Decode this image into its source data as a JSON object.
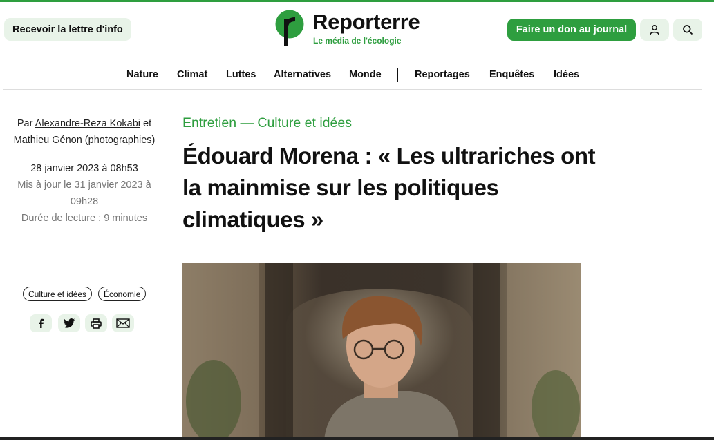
{
  "header": {
    "newsletter_label": "Recevoir la lettre d'info",
    "logo_name": "Reporterre",
    "logo_tagline": "Le média de l'écologie",
    "donate_label": "Faire un don au journal",
    "user_icon": "user-icon",
    "search_icon": "search-icon"
  },
  "nav": {
    "items": [
      {
        "label": "Nature"
      },
      {
        "label": "Climat"
      },
      {
        "label": "Luttes"
      },
      {
        "label": "Alternatives"
      },
      {
        "label": "Monde"
      },
      {
        "label": "Reportages"
      },
      {
        "label": "Enquêtes"
      },
      {
        "label": "Idées"
      }
    ]
  },
  "meta": {
    "by": "Par",
    "author1": "Alexandre-Reza Kokabi",
    "and": "et",
    "author2": "Mathieu Génon (photographies)",
    "published": "28 janvier 2023 à 08h53",
    "updated": "Mis à jour le 31 janvier 2023 à 09h28",
    "reading_time": "Durée de lecture : 9 minutes",
    "tags": [
      {
        "label": "Culture et idées"
      },
      {
        "label": "Économie"
      }
    ],
    "share_icons": [
      "facebook-icon",
      "twitter-icon",
      "print-icon",
      "mail-icon"
    ]
  },
  "article": {
    "kicker": "Entretien — Culture et idées",
    "headline": "Édouard Morena : « Les ultrariches ont la mainmise sur les politiques climatiques »"
  },
  "colors": {
    "accent": "#2e9e3f",
    "accent_light": "#e8f3e8",
    "text": "#111111",
    "muted": "#777777"
  }
}
